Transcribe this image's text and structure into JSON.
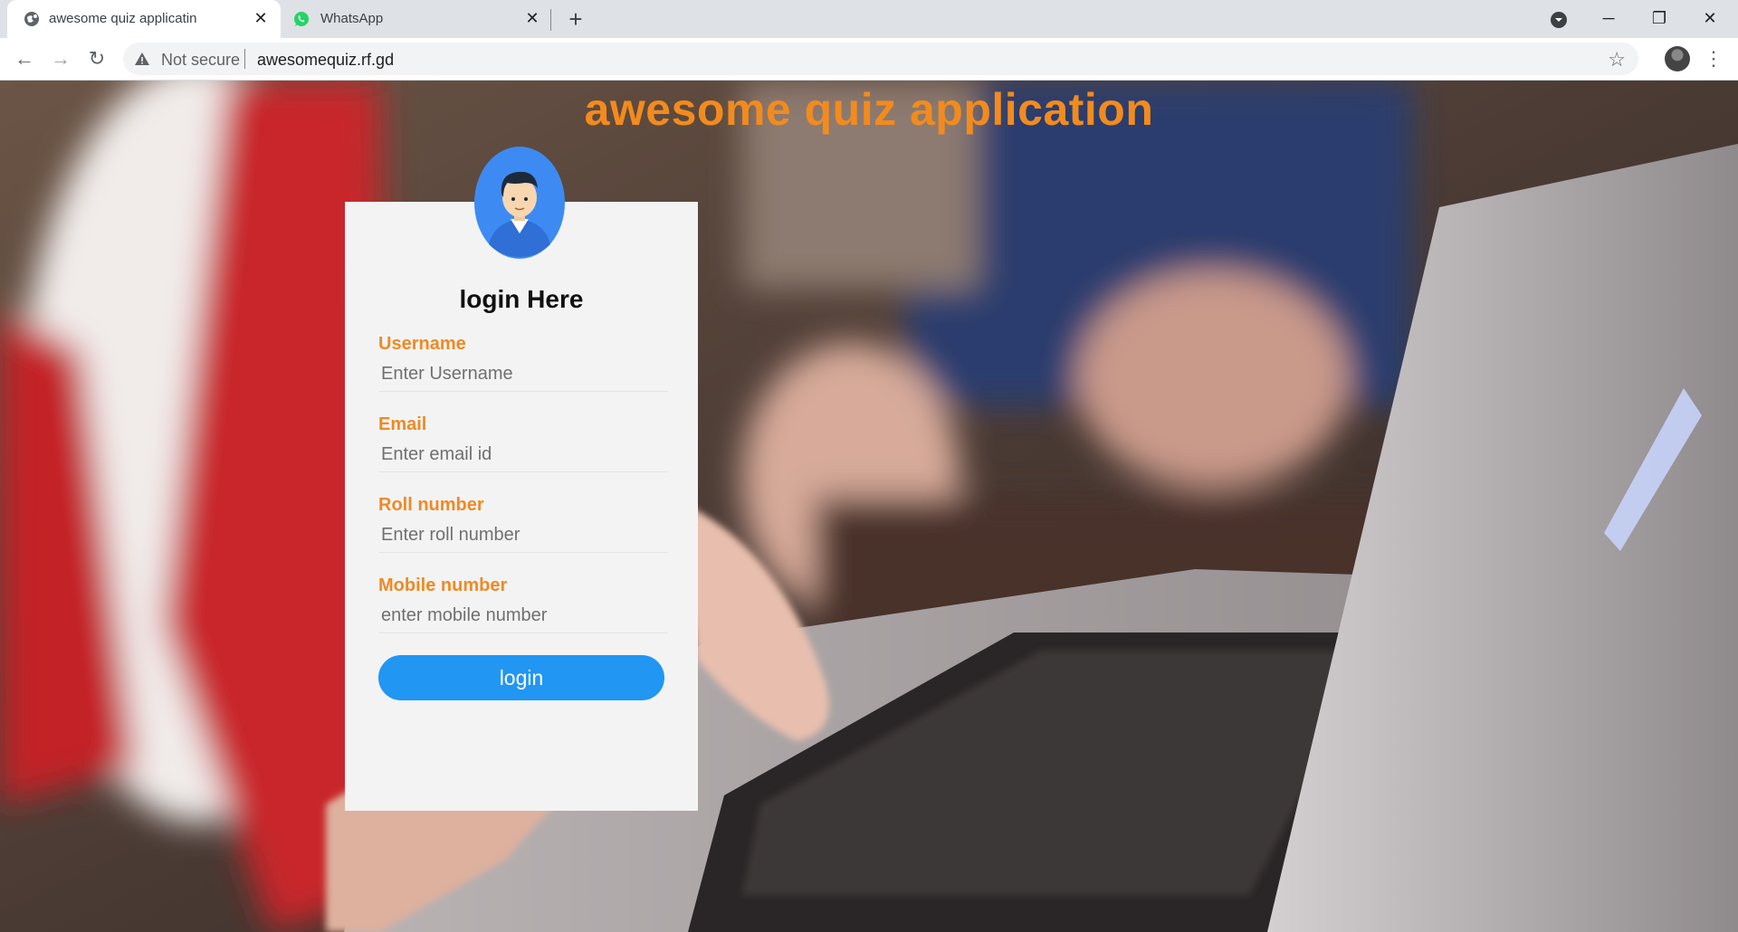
{
  "browser": {
    "tabs": [
      {
        "title": "awesome quiz applicatin",
        "active": true,
        "icon": "globe-icon"
      },
      {
        "title": "WhatsApp",
        "active": false,
        "icon": "whatsapp-icon"
      }
    ],
    "security_label": "Not secure",
    "url": "awesomequiz.rf.gd"
  },
  "page": {
    "heading": "awesome quiz application",
    "form": {
      "title": "login Here",
      "fields": [
        {
          "label": "Username",
          "placeholder": "Enter Username"
        },
        {
          "label": "Email",
          "placeholder": "Enter email id"
        },
        {
          "label": "Roll number",
          "placeholder": "Enter roll number"
        },
        {
          "label": "Mobile number",
          "placeholder": "enter mobile number"
        }
      ],
      "submit_label": "login"
    }
  },
  "colors": {
    "accent_orange": "#f28b1e",
    "button_blue": "#2196f3",
    "card_bg": "#f3f3f4"
  }
}
